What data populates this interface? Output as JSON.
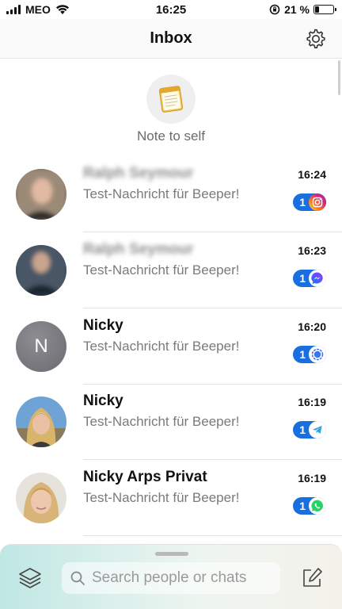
{
  "status_bar": {
    "carrier": "MEO",
    "time": "16:25",
    "battery_text": "21 %",
    "battery_level": 0.21,
    "icons": [
      "signal-icon",
      "wifi-icon",
      "orientation-lock-icon",
      "battery-icon"
    ]
  },
  "header": {
    "title": "Inbox",
    "settings_icon": "gear-icon"
  },
  "note_to_self": {
    "label": "Note to self",
    "icon": "notepad-icon"
  },
  "chats": [
    {
      "name": "Ralph Seymour",
      "name_blurred": true,
      "preview": "Test-Nachricht für Beeper!",
      "time": "16:24",
      "unread": "1",
      "network": "instagram",
      "avatar": "photo-man-blurred"
    },
    {
      "name": "Ralph Seymour",
      "name_blurred": true,
      "preview": "Test-Nachricht für Beeper!",
      "time": "16:23",
      "unread": "1",
      "network": "messenger",
      "avatar": "photo-man-blurred"
    },
    {
      "name": "Nicky",
      "name_blurred": false,
      "preview": "Test-Nachricht für Beeper!",
      "time": "16:20",
      "unread": "1",
      "network": "signal",
      "avatar": "initial",
      "initial": "N"
    },
    {
      "name": "Nicky",
      "name_blurred": false,
      "preview": "Test-Nachricht für Beeper!",
      "time": "16:19",
      "unread": "1",
      "network": "telegram",
      "avatar": "photo-woman"
    },
    {
      "name": "Nicky Arps Privat",
      "name_blurred": false,
      "preview": "Test-Nachricht für Beeper!",
      "time": "16:19",
      "unread": "1",
      "network": "whatsapp",
      "avatar": "photo-woman"
    }
  ],
  "bottom_bar": {
    "search_placeholder": "Search people or chats",
    "icons": [
      "layers-icon",
      "search-icon",
      "compose-icon"
    ]
  },
  "colors": {
    "badge_blue": "#1a6fe0",
    "instagram": "#d6249f",
    "messenger": "#0a7cff",
    "signal": "#3a76f0",
    "telegram": "#2aa3e0",
    "whatsapp": "#25d366"
  }
}
